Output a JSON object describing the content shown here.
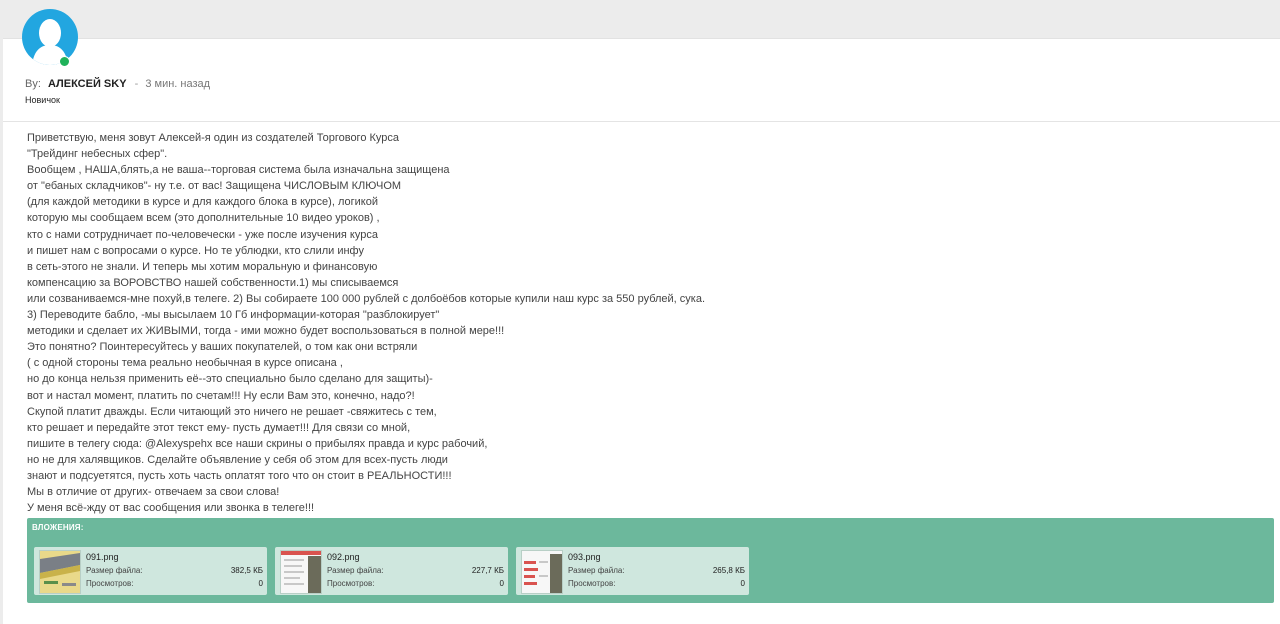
{
  "post": {
    "by_label": "By:",
    "author": "АЛЕКСЕЙ SKY",
    "separator": "-",
    "time": "3 мин. назад",
    "rank": "Новичок",
    "lines": [
      "Приветствую, меня зовут Алексей-я один из создателей Торгового Курса",
      "\"Трейдинг небесных сфер\".",
      "Вообщем , НАША,блять,а не ваша--торговая система была изначальна защищена",
      "от \"ебаных складчиков\"- ну т.е. от вас! Защищена ЧИСЛОВЫМ КЛЮЧОМ",
      "(для каждой методики в курсе и для каждого блока в курсе), логикой",
      "которую мы сообщаем всем (это дополнительные 10 видео уроков) ,",
      "кто с нами сотрудничает по-человечески - уже после изучения курса",
      "и пишет нам с вопросами о курсе. Но те ублюдки, кто слили инфу",
      "в сеть-этого не знали. И теперь мы хотим моральную и финансовую",
      "компенсацию за ВОРОВСТВО нашей собственности.1) мы списываемся",
      "или созваниваемся-мне похуй,в телеге. 2) Вы собираете 100 000 рублей с долбоёбов которые купили наш курс за 550 рублей, сука.",
      "3) Переводите бабло, -мы высылаем 10 Гб информации-которая \"разблокирует\"",
      "методики и сделает их ЖИВЫМИ, тогда - ими можно будет воспользоваться в полной мере!!!",
      "Это понятно? Поинтересуйтесь у ваших покупателей, о том как они встряли",
      "( с одной стороны тема реально необычная в курсе описана ,",
      "но до конца нельзя применить её--это специально было сделано для защиты)-",
      "вот и настал момент, платить по счетам!!! Ну если Вам это, конечно, надо?!",
      "Скупой платит дважды. Если читающий это ничего не решает -свяжитесь с тем,",
      "кто решает и передайте этот текст ему- пусть думает!!! Для связи со мной,",
      "пишите в телегу сюда: @Alexyspehx все наши скрины о прибылях правда и курс рабочий,",
      "но не для халявщиков. Сделайте объявление у себя об этом для всех-пусть люди",
      "знают и подсуетятся, пусть хоть часть оплатят того что он стоит в РЕАЛЬНОСТИ!!!",
      "Мы в отличие от других- отвечаем за свои слова!",
      "У меня всё-жду от вас сообщения или звонка в телеге!!!"
    ]
  },
  "attachments": {
    "title": "ВЛОЖЕНИЯ:",
    "size_label": "Размер файла:",
    "views_label": "Просмотров:",
    "items": [
      {
        "name": "091.png",
        "size": "382,5 КБ",
        "views": "0"
      },
      {
        "name": "092.png",
        "size": "227,7 КБ",
        "views": "0"
      },
      {
        "name": "093.png",
        "size": "265,8 КБ",
        "views": "0"
      }
    ]
  },
  "colors": {
    "avatar": "#22a6e0",
    "online": "#1fb25a",
    "attachments_bg": "#6cb89c",
    "attachment_item_bg": "#cfe7de"
  }
}
